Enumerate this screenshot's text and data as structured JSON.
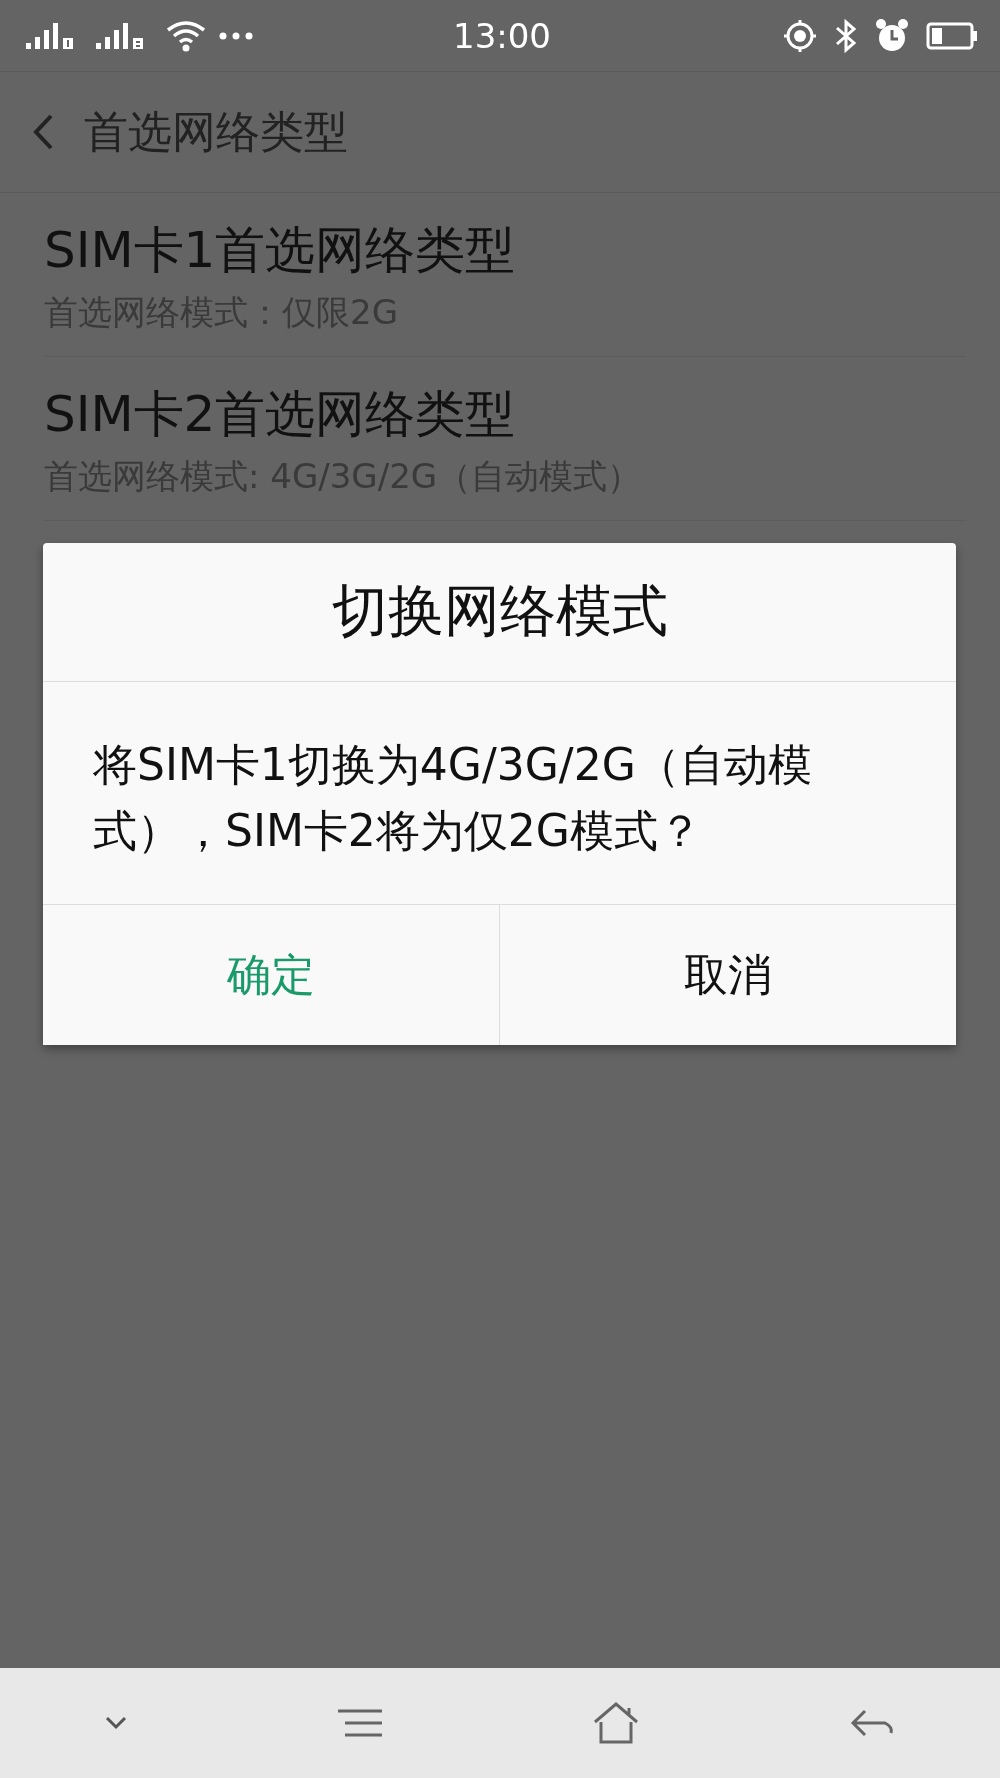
{
  "status_bar": {
    "time": "13:00"
  },
  "header": {
    "title": "首选网络类型"
  },
  "items": [
    {
      "title": "SIM卡1首选网络类型",
      "subtitle": "首选网络模式：仅限2G"
    },
    {
      "title": "SIM卡2首选网络类型",
      "subtitle": "首选网络模式: 4G/3G/2G（自动模式）"
    }
  ],
  "dialog": {
    "title": "切换网络模式",
    "message": "将SIM卡1切换为4G/3G/2G（自动模式），SIM卡2将为仅2G模式？",
    "buttons": [
      {
        "label": "确定",
        "kind": "primary"
      },
      {
        "label": "取消",
        "kind": "normal"
      }
    ]
  }
}
